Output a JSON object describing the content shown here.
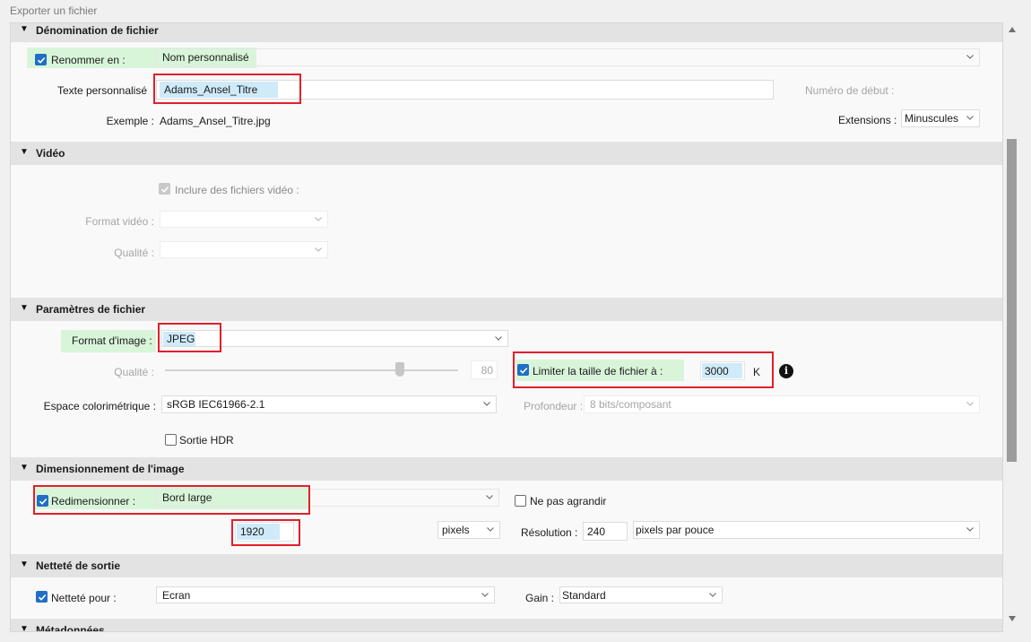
{
  "window": {
    "title": "Exporter un fichier"
  },
  "sections": {
    "naming": {
      "header": "Dénomination de fichier",
      "rename_label": "Renommer en :",
      "rename_value": "Nom personnalisé",
      "custom_text_label": "Texte personnalisé",
      "custom_text_value": "Adams_Ansel_Titre",
      "start_number_label": "Numéro de début :",
      "example_label": "Exemple :",
      "example_value": "Adams_Ansel_Titre.jpg",
      "extensions_label": "Extensions :",
      "extensions_value": "Minuscules"
    },
    "video": {
      "header": "Vidéo",
      "include_label": "Inclure des fichiers vidéo :",
      "format_label": "Format vidéo :",
      "quality_label": "Qualité :"
    },
    "file_settings": {
      "header": "Paramètres de fichier",
      "format_label": "Format d'image :",
      "format_value": "JPEG",
      "quality_label": "Qualité :",
      "quality_value": "80",
      "quality_level": 0.8,
      "limit_label": "Limiter la taille de fichier à :",
      "limit_value": "3000",
      "limit_unit": "K",
      "colorspace_label": "Espace colorimétrique :",
      "colorspace_value": "sRGB IEC61966-2.1",
      "depth_label": "Profondeur :",
      "depth_value": "8 bits/composant",
      "hdr_label": "Sortie HDR"
    },
    "sizing": {
      "header": "Dimensionnement de l'image",
      "resize_label": "Redimensionner :",
      "resize_value": "Bord large",
      "no_enlarge_label": "Ne pas agrandir",
      "size_value": "1920",
      "unit_value": "pixels",
      "resolution_label": "Résolution :",
      "resolution_value": "240",
      "resolution_unit_value": "pixels par pouce"
    },
    "sharpening": {
      "header": "Netteté de sortie",
      "sharpen_label": "Netteté pour :",
      "sharpen_value": "Ecran",
      "gain_label": "Gain :",
      "gain_value": "Standard"
    },
    "metadata": {
      "header": "Métadonnées"
    }
  },
  "colors": {
    "accent": "#1f6fc5",
    "highlight_red": "#e0202b",
    "green_bg": "#d9f5d9",
    "blue_bg": "#cfeaf9",
    "header_bg": "#e3e3e3"
  }
}
